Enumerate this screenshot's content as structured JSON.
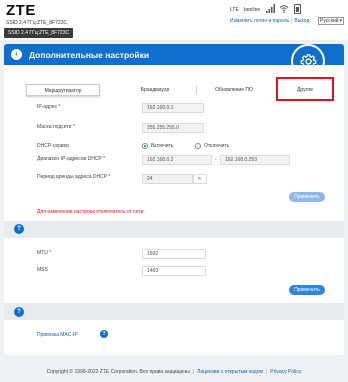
{
  "header": {
    "logo": "ZTE",
    "ssid_line": "SSID 2.4 ГГц:ZTE_8F723C",
    "ssid_tooltip": "SSID 2.4 ГГц:ZTE_8F723C",
    "network_type": "LTE",
    "operator": "beeline",
    "change_login_link": "Изменить логин и пароль",
    "logout_link": "Выход",
    "language": "Русский"
  },
  "page": {
    "title": "Дополнительные настройки"
  },
  "tabs": [
    {
      "label": "Маршрутизатор",
      "active": true
    },
    {
      "label": "Брандмауэр",
      "active": false
    },
    {
      "label": "Обновление ПО",
      "active": false
    },
    {
      "label": "Другое",
      "active": false
    }
  ],
  "router": {
    "ip_label": "IP-адрес",
    "ip_value": "192.168.0.1",
    "mask_label": "Маска подсети",
    "mask_value": "255.255.255.0",
    "dhcp_label": "DHCP-сервер",
    "dhcp_on": "Включить",
    "dhcp_off": "Отключить",
    "dhcp_range_label": "Диапазон IP-адресов DHCP",
    "dhcp_start": "192.168.0.2",
    "range_sep": "-",
    "dhcp_end": "192.168.0.253",
    "lease_label": "Период аренды адреса DHCP",
    "lease_value": "24",
    "lease_unit": "ч",
    "apply": "Применить",
    "warning": "Для изменения настроек отключитесь от сети."
  },
  "mtu": {
    "help_icon": "?",
    "mtu_label": "MTU",
    "mtu_value": "1500",
    "mss_label": "MSS",
    "mss_value": "1460",
    "apply": "Применить"
  },
  "mac": {
    "help_icon": "?",
    "link": "Привязка MAC-IP",
    "help_icon2": "?"
  },
  "footer": {
    "copyright": "Copyright © 1998-2022 ZTE Corporation. Все права защищены",
    "license_link": "Лицензии с открытым кодом",
    "privacy_link": "Privacy Policy"
  },
  "colors": {
    "brand_blue": "#0f6fcf",
    "highlight_red": "#e0141e"
  },
  "icons": [
    "signal-icon",
    "wifi-icon",
    "battery-icon",
    "gear-icon",
    "back-arrow-icon",
    "help-icon"
  ]
}
